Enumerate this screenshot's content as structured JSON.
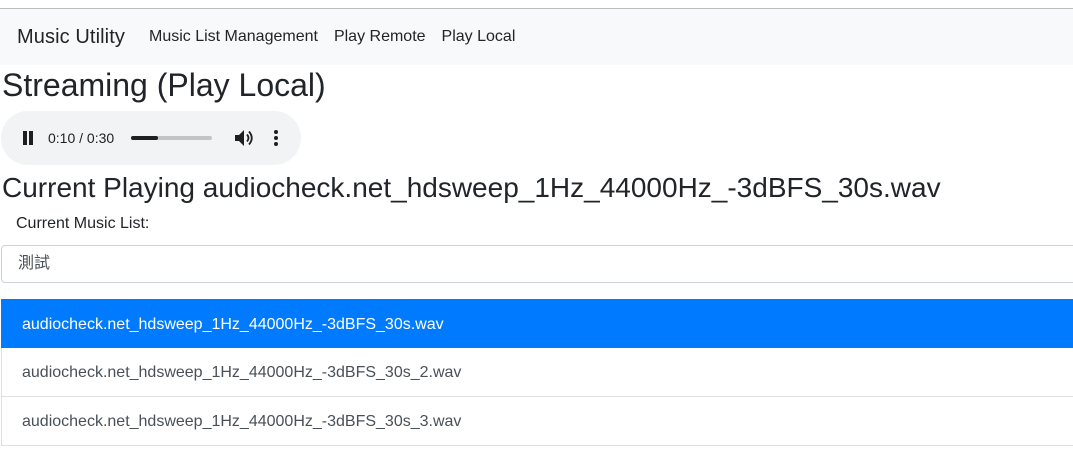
{
  "navbar": {
    "brand": "Music Utility",
    "links": [
      "Music List Management",
      "Play Remote",
      "Play Local"
    ]
  },
  "page": {
    "title": "Streaming (Play Local)"
  },
  "player": {
    "time": "0:10 / 0:30",
    "progress": 0.33,
    "state": "playing",
    "icons": [
      "pause-icon",
      "volume-icon",
      "more-icon"
    ]
  },
  "now_playing": {
    "text": "Current Playing audiocheck.net_hdsweep_1Hz_44000Hz_-3dBFS_30s.wav"
  },
  "music_list": {
    "label": "Current Music List:",
    "selected": "測試"
  },
  "songs": [
    "audiocheck.net_hdsweep_1Hz_44000Hz_-3dBFS_30s.wav",
    "audiocheck.net_hdsweep_1Hz_44000Hz_-3dBFS_30s_2.wav",
    "audiocheck.net_hdsweep_1Hz_44000Hz_-3dBFS_30s_3.wav"
  ],
  "active_song_index": 0,
  "colors": {
    "accent": "#007bff",
    "navbar_bg": "#f8f9fa",
    "player_bg": "#f1f3f4"
  }
}
